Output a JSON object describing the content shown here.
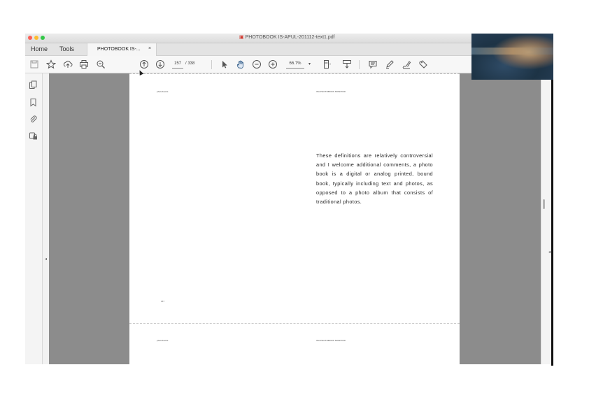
{
  "window": {
    "title": "PHOTOBOOK IS-APUL-201112-text1.pdf"
  },
  "tabs": {
    "home_label": "Home",
    "tools_label": "Tools",
    "document_tab_label": "PHOTOBOOK IS-...",
    "close_glyph": "×"
  },
  "toolbar": {
    "current_page": "157",
    "total_pages": "/ 338",
    "zoom": "66.7%",
    "zoom_caret": "▾"
  },
  "page": {
    "running_head_left": "photobooks",
    "running_head_right": "ISA PHOTOBOOK MONITOR",
    "body_paragraph": "These definitions are relatively controversial and I welcome additional comments, a photo book is a digital or analog printed, bound book, typically including text and photos, as opposed to a photo album that consists of traditional photos.",
    "folio": "157",
    "next_running_head_left": "photobooks",
    "next_running_head_right": "ISA PHOTOBOOK MONITOR"
  },
  "icons": {
    "left_panel_collapse": "◂",
    "right_panel_collapse": "◂"
  }
}
